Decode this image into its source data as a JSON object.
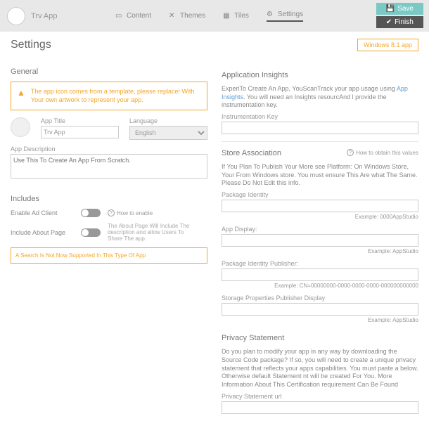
{
  "header": {
    "app_name": "Trv App",
    "nav": {
      "content": "Content",
      "themes": "Themes",
      "tiles": "Tiles",
      "settings": "Settings"
    },
    "save": "Save",
    "finish": "Finish"
  },
  "page": {
    "title": "Settings",
    "badge": "Windows 8.1 app"
  },
  "general": {
    "title": "General",
    "warning": "The app icon comes from a template, please replace! With Your own artwork to represent your app.",
    "app_title_label": "App Title",
    "app_title": "Trv App",
    "lang_label": "Language",
    "lang": "English",
    "desc_label": "App Description",
    "desc_placeholder": "Use This To Create An App From Scratch."
  },
  "includes": {
    "title": "Includes",
    "ad_label": "Enable Ad Client",
    "how": "How to enable",
    "about_label": "Include About Page",
    "about_desc": "The About Page Will Include The description and allow Users To Share The app.",
    "search_info": "A Search Is Not Now Supported In This Type Of App"
  },
  "insights": {
    "title": "Application Insights",
    "desc1": "ExperiTo Create An App, YouScanTrack your app usage using ",
    "link": "App Insights",
    "desc2": ". You will need an Insights resourcAnd l provide the instrumentation key.",
    "key_label": "Instrumentation Key"
  },
  "store": {
    "title": "Store Association",
    "how": "How to obtain this values",
    "desc": "If You Plan To Publish Your More see Platform: On Windows Store, Your From Windows store. You must ensure This Are what The Same. Please Do Not Edit this info.",
    "pkg_identity": "Package Identity",
    "pkg_ex": "Example: 0000AppStudio",
    "app_display": "App Display:",
    "app_ex": "Example: AppStudio",
    "pub_label": "Package Identity Publisher:",
    "pub_ex": "Example: CN=00000000-0000-0000-0000-000000000000",
    "pub_display": "Storage Properties Publisher Display",
    "pub_display_ex": "Example: AppStudio"
  },
  "privacy": {
    "title": "Privacy Statement",
    "desc": "Do you plan to modify your app in any way by downloading the Source Code package? If so, you will need to create a unique privacy statement that reflects your apps capabilities. You must paste a below. Otherwise default Statement nt will be created For You. More Information About This Certification requirement Can Be Found",
    "url_label": "Privacy Statement url"
  }
}
